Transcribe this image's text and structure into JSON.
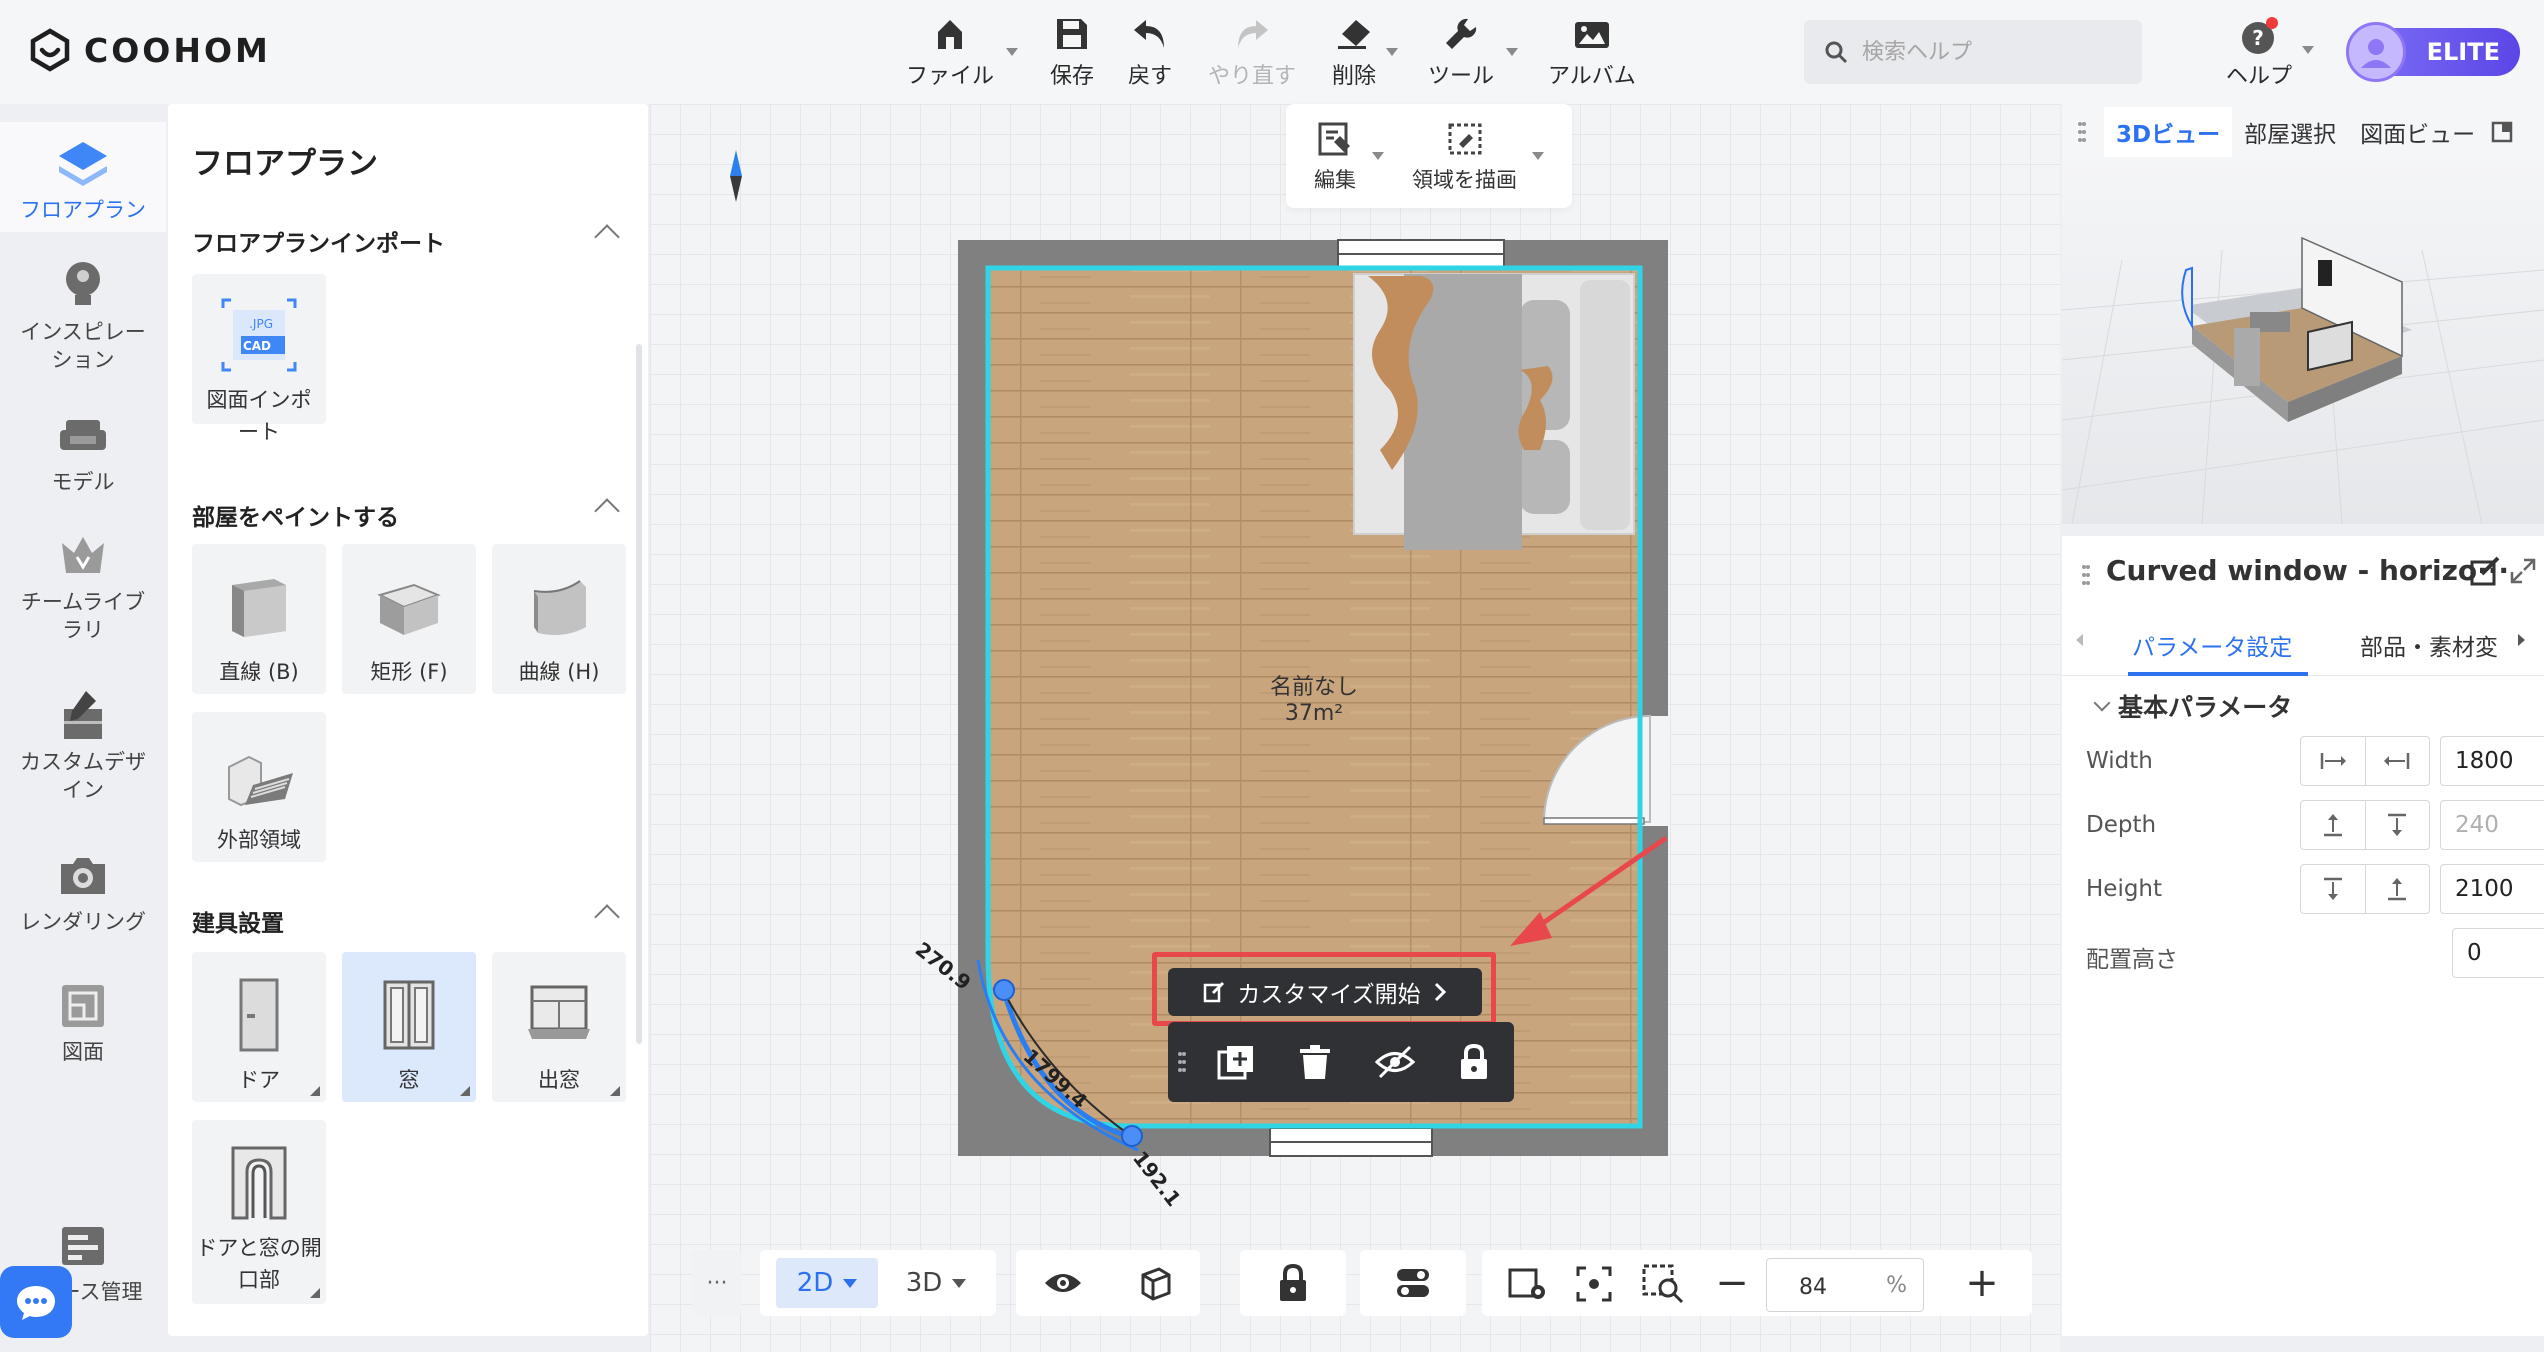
{
  "app": {
    "brand": "COOHOM"
  },
  "toolbar": {
    "items": [
      {
        "label": "ファイル",
        "icon": "file-icon"
      },
      {
        "label": "保存",
        "icon": "save-icon"
      },
      {
        "label": "戻す",
        "icon": "undo-icon"
      },
      {
        "label": "やり直す",
        "icon": "redo-icon"
      },
      {
        "label": "削除",
        "icon": "eraser-icon"
      },
      {
        "label": "ツール",
        "icon": "wrench-icon"
      },
      {
        "label": "アルバム",
        "icon": "album-icon"
      }
    ],
    "search_placeholder": "検索ヘルプ",
    "help_label": "ヘルプ",
    "elite_label": "ELITE"
  },
  "leftnav": {
    "items": [
      {
        "label": "フロアプラン",
        "icon": "floorplan-icon"
      },
      {
        "label": "インスピレーション",
        "icon": "lightbulb-icon"
      },
      {
        "label": "モデル",
        "icon": "sofa-icon"
      },
      {
        "label": "チームライブラリ",
        "icon": "crown-icon"
      },
      {
        "label": "カスタムデザイン",
        "icon": "custom-design-icon"
      },
      {
        "label": "レンダリング",
        "icon": "camera-icon"
      },
      {
        "label": "図面",
        "icon": "drawing-icon"
      },
      {
        "label": "ース管理",
        "icon": "resource-icon"
      }
    ]
  },
  "panel": {
    "title": "フロアプラン",
    "sections": [
      {
        "title": "フロアプランインポート",
        "cards": [
          "図面インポート"
        ]
      },
      {
        "title": "部屋をペイントする",
        "cards": [
          "直線 (B)",
          "矩形 (F)",
          "曲線 (H)",
          "外部領域"
        ]
      },
      {
        "title": "建具設置",
        "cards": [
          "ドア",
          "窓",
          "出窓",
          "ドアと窓の開口部"
        ]
      }
    ],
    "import_badges": {
      "jpg": ".JPG",
      "cad": "CAD"
    }
  },
  "edit_toolbar": {
    "edit_label": "編集",
    "draw_area_label": "領域を描画"
  },
  "canvas": {
    "room_name": "名前なし",
    "room_area": "37m²",
    "dimensions": [
      "270.9",
      "1799.4",
      "192.1"
    ],
    "customize_label": "カスタマイズ開始"
  },
  "bottom": {
    "more": "···",
    "mode_2d": "2D",
    "mode_3d": "3D",
    "zoom_value": "84",
    "zoom_unit": "%",
    "minus": "−",
    "plus": "+"
  },
  "right": {
    "tabs": [
      "3Dビュー",
      "部屋選択",
      "図面ビュー"
    ],
    "object_title": "Curved window - horizo···",
    "prop_tabs": [
      "パラメータ設定",
      "部品・素材変"
    ],
    "section_title": "基本パラメータ",
    "params": [
      {
        "label": "Width",
        "value": "1800",
        "disabled": false
      },
      {
        "label": "Depth",
        "value": "240",
        "disabled": true
      },
      {
        "label": "Height",
        "value": "2100",
        "disabled": false
      },
      {
        "label": "配置高さ",
        "value": "0",
        "disabled": false
      }
    ]
  },
  "colors": {
    "accent": "#2c72f0",
    "elite": "#6a57ee",
    "highlight": "#e8484c",
    "room_outline": "#2fd4e6",
    "floor": "#c9a57e",
    "wall": "#808080"
  }
}
